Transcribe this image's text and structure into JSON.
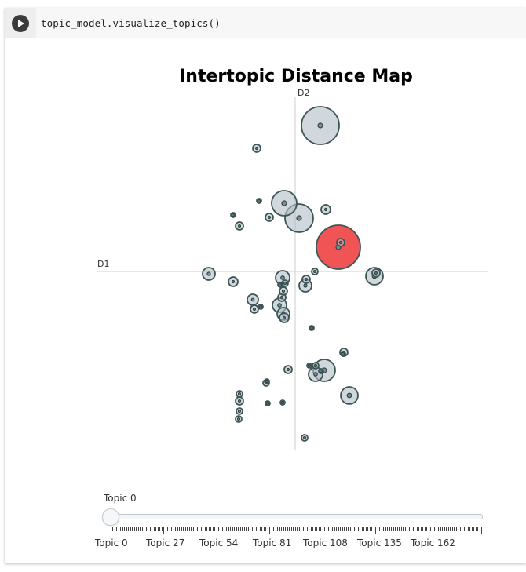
{
  "cell": {
    "code": "topic_model.visualize_topics()"
  },
  "chart_data": {
    "type": "scatter",
    "title": "Intertopic Distance Map",
    "xlabel": "D1",
    "ylabel": "D2",
    "grid": false,
    "highlight_color": "#ef4b4b",
    "bubble_fill": "#b0bcc6",
    "bubble_stroke": "#3e5555",
    "xlim": [
      -12.5,
      12.5
    ],
    "ylim": [
      -11.5,
      11.5
    ],
    "points": [
      {
        "topic": 0,
        "x": 5.5,
        "y": 3.1,
        "r": 28,
        "highlight": true
      },
      {
        "topic": 1,
        "x": 3.2,
        "y": 18.6,
        "r": 24
      },
      {
        "topic": 2,
        "x": 0.5,
        "y": 6.8,
        "r": 18
      },
      {
        "topic": 3,
        "x": -1.4,
        "y": 8.7,
        "r": 16
      },
      {
        "topic": 4,
        "x": 3.7,
        "y": -12.6,
        "r": 14
      },
      {
        "topic": 5,
        "x": 6.9,
        "y": -15.8,
        "r": 11
      },
      {
        "topic": 6,
        "x": 10.1,
        "y": -0.6,
        "r": 11
      },
      {
        "topic": 7,
        "x": -11.0,
        "y": -0.3,
        "r": 8
      },
      {
        "topic": 8,
        "x": -2.0,
        "y": -4.3,
        "r": 9
      },
      {
        "topic": 9,
        "x": -1.6,
        "y": -0.8,
        "r": 9
      },
      {
        "topic": 10,
        "x": 1.3,
        "y": -1.8,
        "r": 8
      },
      {
        "topic": 11,
        "x": 2.6,
        "y": -13.1,
        "r": 9
      },
      {
        "topic": 12,
        "x": -5.4,
        "y": -3.6,
        "r": 7
      },
      {
        "topic": 13,
        "x": -7.9,
        "y": -1.3,
        "r": 6
      },
      {
        "topic": 14,
        "x": 3.9,
        "y": 7.9,
        "r": 6
      },
      {
        "topic": 15,
        "x": -1.5,
        "y": -5.4,
        "r": 8
      },
      {
        "topic": 16,
        "x": -4.9,
        "y": 15.7,
        "r": 5
      },
      {
        "topic": 17,
        "x": -7.1,
        "y": 5.8,
        "r": 5
      },
      {
        "topic": 18,
        "x": -3.3,
        "y": 6.9,
        "r": 5
      },
      {
        "topic": 19,
        "x": -7.9,
        "y": 7.2,
        "r": 3
      },
      {
        "topic": 20,
        "x": -4.6,
        "y": 9.0,
        "r": 3
      },
      {
        "topic": 21,
        "x": 2.5,
        "y": 0.0,
        "r": 4
      },
      {
        "topic": 22,
        "x": 2.1,
        "y": -7.2,
        "r": 3
      },
      {
        "topic": 23,
        "x": 6.2,
        "y": -10.3,
        "r": 5
      },
      {
        "topic": 24,
        "x": -0.9,
        "y": -12.5,
        "r": 5
      },
      {
        "topic": 25,
        "x": -3.7,
        "y": -14.2,
        "r": 4
      },
      {
        "topic": 26,
        "x": -7.1,
        "y": -16.5,
        "r": 5
      },
      {
        "topic": 27,
        "x": -7.1,
        "y": -17.8,
        "r": 4
      },
      {
        "topic": 28,
        "x": -7.2,
        "y": -18.8,
        "r": 4
      },
      {
        "topic": 29,
        "x": -3.5,
        "y": -16.8,
        "r": 3
      },
      {
        "topic": 30,
        "x": -1.6,
        "y": -16.7,
        "r": 3
      },
      {
        "topic": 31,
        "x": 1.2,
        "y": -21.2,
        "r": 4
      },
      {
        "topic": 32,
        "x": 1.4,
        "y": -1.0,
        "r": 5
      },
      {
        "topic": 33,
        "x": -1.7,
        "y": -3.3,
        "r": 5
      },
      {
        "topic": 34,
        "x": -1.4,
        "y": -5.9,
        "r": 6
      },
      {
        "topic": 35,
        "x": -5.2,
        "y": -4.8,
        "r": 5
      },
      {
        "topic": 36,
        "x": -4.4,
        "y": -4.5,
        "r": 3
      },
      {
        "topic": 37,
        "x": -1.5,
        "y": -2.5,
        "r": 5
      },
      {
        "topic": 38,
        "x": 5.8,
        "y": 3.7,
        "r": 5
      },
      {
        "topic": 39,
        "x": 10.3,
        "y": -0.2,
        "r": 5
      },
      {
        "topic": 40,
        "x": 2.6,
        "y": -12.0,
        "r": 4
      },
      {
        "topic": 41,
        "x": 1.8,
        "y": -12.0,
        "r": 3
      },
      {
        "topic": 42,
        "x": -7.1,
        "y": -15.6,
        "r": 4
      },
      {
        "topic": 43,
        "x": 6.1,
        "y": -10.5,
        "r": 3
      },
      {
        "topic": 44,
        "x": -3.6,
        "y": -14.0,
        "r": 3
      },
      {
        "topic": 45,
        "x": -1.3,
        "y": -1.5,
        "r": 4
      },
      {
        "topic": 46,
        "x": -1.9,
        "y": -1.7,
        "r": 3
      },
      {
        "topic": 47,
        "x": 3.3,
        "y": -12.7,
        "r": 3
      }
    ]
  },
  "slider": {
    "current_label": "Topic 0",
    "ticks": [
      "Topic 0",
      "Topic 27",
      "Topic 54",
      "Topic 81",
      "Topic 108",
      "Topic 135",
      "Topic 162"
    ]
  }
}
